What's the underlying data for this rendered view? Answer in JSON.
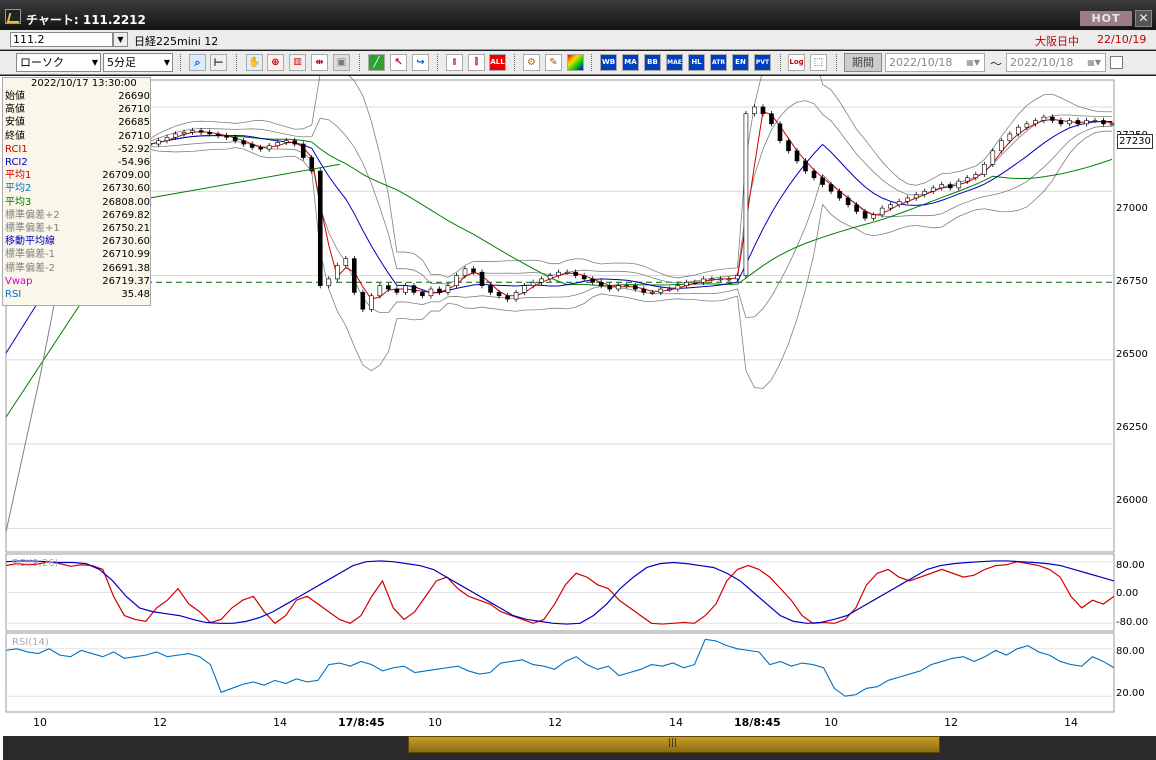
{
  "window": {
    "title": "チャート: 111.2212",
    "hot": "HOT",
    "close": "✕"
  },
  "symbolbar": {
    "code": "111.2",
    "name": "日経225mini 12",
    "exchange": "大阪日中",
    "date": "22/10/19"
  },
  "toolbar": {
    "chart_type": "ローソク",
    "interval": "5分足",
    "period_button": "期間",
    "from_date": "2022/10/18",
    "to_date": "2022/10/18",
    "tilde": "〜",
    "buttons": [
      "ALL",
      "WB",
      "MA",
      "BB",
      "MAE",
      "HL",
      "ATR",
      "EN",
      "PVT",
      "Log"
    ]
  },
  "info_panel": {
    "datetime": "2022/10/17 13:30:00",
    "rows": [
      {
        "label": "始値",
        "value": "26690",
        "color": "#000000"
      },
      {
        "label": "高値",
        "value": "26710",
        "color": "#000000"
      },
      {
        "label": "安値",
        "value": "26685",
        "color": "#000000"
      },
      {
        "label": "終値",
        "value": "26710",
        "color": "#000000"
      },
      {
        "label": "RCI1",
        "value": "-52.92",
        "color": "#d00000"
      },
      {
        "label": "RCI2",
        "value": "-54.96",
        "color": "#0000c0"
      },
      {
        "label": "平均1",
        "value": "26709.00",
        "color": "#d00000"
      },
      {
        "label": "平均2",
        "value": "26730.60",
        "color": "#0070c0"
      },
      {
        "label": "平均3",
        "value": "26808.00",
        "color": "#008000"
      },
      {
        "label": "標準偏差+2",
        "value": "26769.82",
        "color": "#808080"
      },
      {
        "label": "標準偏差+1",
        "value": "26750.21",
        "color": "#808080"
      },
      {
        "label": "移動平均線",
        "value": "26730.60",
        "color": "#0000c0"
      },
      {
        "label": "標準偏差-1",
        "value": "26710.99",
        "color": "#808080"
      },
      {
        "label": "標準偏差-2",
        "value": "26691.38",
        "color": "#808080"
      },
      {
        "label": "Vwap",
        "value": "26719.37",
        "color": "#d000d0"
      },
      {
        "label": "RSI",
        "value": "35.48",
        "color": "#0070c0"
      }
    ]
  },
  "price_tag": "27230",
  "panels": {
    "rci_title": "RCI(9,26)",
    "rsi_title": "RSI(14)"
  },
  "chart_data": {
    "type": "line",
    "price_axis": {
      "ticks": [
        "27250",
        "27000",
        "26750",
        "26500",
        "26250",
        "26000"
      ],
      "ylim": [
        25930,
        27330
      ],
      "current_price": 27230,
      "vwap_level": 26730
    },
    "rci_axis": {
      "ticks": [
        "80.00",
        "0.00",
        "-80.00"
      ],
      "ylim": [
        -100,
        100
      ]
    },
    "rsi_axis": {
      "ticks": [
        "80.00",
        "20.00"
      ],
      "ylim": [
        0,
        100
      ]
    },
    "x_ticks": [
      {
        "label": "10",
        "bold": false
      },
      {
        "label": "12",
        "bold": false
      },
      {
        "label": "14",
        "bold": false
      },
      {
        "label": "17/8:45",
        "bold": true
      },
      {
        "label": "10",
        "bold": false
      },
      {
        "label": "12",
        "bold": false
      },
      {
        "label": "14",
        "bold": false
      },
      {
        "label": "18/8:45",
        "bold": true
      },
      {
        "label": "10",
        "bold": false
      },
      {
        "label": "12",
        "bold": false
      },
      {
        "label": "14",
        "bold": false
      }
    ],
    "price_close": [
      27140,
      27150,
      27160,
      27170,
      27175,
      27180,
      27175,
      27170,
      27165,
      27160,
      27150,
      27140,
      27130,
      27125,
      27135,
      27145,
      27150,
      27140,
      27100,
      27060,
      26720,
      26740,
      26780,
      26800,
      26700,
      26650,
      26690,
      26720,
      26710,
      26700,
      26720,
      26700,
      26690,
      26710,
      26700,
      26720,
      26750,
      26770,
      26760,
      26720,
      26700,
      26690,
      26680,
      26700,
      26720,
      26730,
      26740,
      26750,
      26760,
      26760,
      26750,
      26740,
      26730,
      26720,
      26710,
      26720,
      26720,
      26710,
      26700,
      26700,
      26710,
      26710,
      26720,
      26730,
      26730,
      26740,
      26740,
      26740,
      26740,
      26750,
      27230,
      27250,
      27230,
      27200,
      27150,
      27120,
      27090,
      27060,
      27040,
      27020,
      27000,
      26980,
      26960,
      26940,
      26920,
      26930,
      26950,
      26960,
      26970,
      26980,
      26990,
      27000,
      27010,
      27020,
      27010,
      27030,
      27040,
      27050,
      27080,
      27120,
      27150,
      27170,
      27190,
      27200,
      27210,
      27220,
      27210,
      27200,
      27210,
      27200,
      27210,
      27210,
      27200,
      27200
    ],
    "rci1": [
      70,
      75,
      72,
      74,
      80,
      75,
      68,
      72,
      70,
      60,
      -10,
      -60,
      -70,
      -75,
      -40,
      -20,
      10,
      -30,
      -50,
      -78,
      -70,
      -40,
      -20,
      -10,
      -50,
      -80,
      -60,
      -20,
      -10,
      -30,
      -50,
      -70,
      -80,
      -60,
      -10,
      30,
      -40,
      -70,
      -50,
      -10,
      30,
      40,
      10,
      -10,
      -20,
      -30,
      -50,
      -60,
      -70,
      -80,
      -70,
      -30,
      20,
      50,
      40,
      20,
      10,
      -20,
      -40,
      -60,
      -80,
      -82,
      -80,
      -78,
      -80,
      -60,
      -30,
      30,
      60,
      70,
      60,
      40,
      10,
      -20,
      -60,
      -80,
      -78,
      -80,
      -70,
      -40,
      20,
      50,
      60,
      40,
      30,
      40,
      50,
      60,
      50,
      40,
      45,
      60,
      70,
      72,
      80,
      75,
      70,
      60,
      40,
      -10,
      -40,
      -20,
      -30,
      -10
    ],
    "rci2": [
      80,
      82,
      82,
      80,
      78,
      78,
      75,
      60,
      30,
      -10,
      -40,
      -50,
      -55,
      -60,
      -70,
      -78,
      -80,
      -80,
      -75,
      -65,
      -50,
      -30,
      -10,
      10,
      30,
      50,
      70,
      80,
      82,
      80,
      75,
      70,
      60,
      40,
      20,
      0,
      -20,
      -40,
      -60,
      -70,
      -75,
      -80,
      -82,
      -80,
      -60,
      -30,
      10,
      40,
      65,
      75,
      78,
      75,
      70,
      65,
      50,
      30,
      0,
      -30,
      -60,
      -75,
      -80,
      -78,
      -70,
      -60,
      -40,
      -20,
      0,
      20,
      40,
      60,
      70,
      75,
      78,
      80,
      82,
      82,
      80,
      78,
      75,
      70,
      60,
      50,
      40,
      30
    ],
    "rsi": [
      78,
      80,
      76,
      74,
      80,
      72,
      70,
      78,
      74,
      70,
      76,
      68,
      70,
      72,
      76,
      70,
      72,
      74,
      70,
      60,
      25,
      30,
      35,
      38,
      34,
      40,
      36,
      42,
      38,
      40,
      60,
      62,
      58,
      64,
      60,
      52,
      56,
      58,
      50,
      52,
      54,
      56,
      58,
      52,
      48,
      50,
      62,
      64,
      66,
      60,
      58,
      54,
      64,
      70,
      60,
      54,
      58,
      46,
      50,
      54,
      60,
      58,
      62,
      56,
      60,
      92,
      90,
      84,
      80,
      78,
      76,
      60,
      64,
      58,
      62,
      60,
      56,
      30,
      20,
      22,
      30,
      32,
      40,
      44,
      48,
      52,
      60,
      64,
      68,
      70,
      64,
      70,
      78,
      72,
      80,
      84,
      76,
      72,
      64,
      60,
      58,
      70,
      64,
      56
    ],
    "series_colors": {
      "price": "#000000",
      "avg1": "#d00000",
      "avg2": "#0000c0",
      "avg3": "#008000",
      "vwap": "#d000d0",
      "band": "#808080",
      "rsi": "#0070c0",
      "rci1": "#d00000",
      "rci2": "#0000c0"
    }
  }
}
